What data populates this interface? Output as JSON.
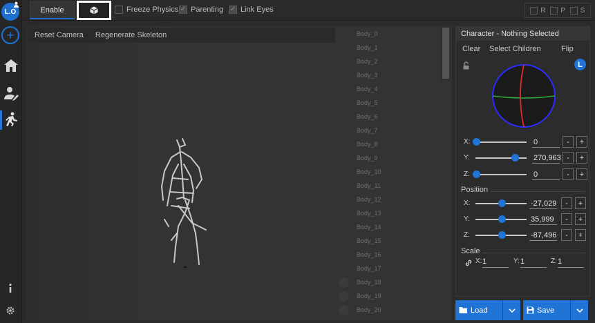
{
  "rail": {
    "avatar_text": "L.O",
    "items": [
      "user-add-icon",
      "home-icon",
      "character-edit-icon",
      "running-icon"
    ],
    "bottom": [
      "info-icon",
      "settings-icon"
    ]
  },
  "toolbar": {
    "enable_label": "Enable",
    "freeze_physics_label": "Freeze Physics",
    "freeze_physics_checked": false,
    "parenting_label": "Parenting",
    "parenting_checked": true,
    "link_eyes_label": "Link Eyes",
    "link_eyes_checked": true,
    "rps": [
      {
        "label": "R",
        "checked": false
      },
      {
        "label": "P",
        "checked": false
      },
      {
        "label": "S",
        "checked": false
      }
    ]
  },
  "viewport": {
    "reset_camera_label": "Reset Camera",
    "regenerate_skeleton_label": "Regenerate Skeleton",
    "bones": [
      "Body_0",
      "Body_1",
      "Body_2",
      "Body_3",
      "Body_4",
      "Body_5",
      "Body_6",
      "Body_7",
      "Body_8",
      "Body_9",
      "Body_10",
      "Body_11",
      "Body_12",
      "Body_13",
      "Body_14",
      "Body_15",
      "Body_16",
      "Body_17",
      "Body_18",
      "Body_19",
      "Body_20"
    ]
  },
  "panel": {
    "title": "Character - Nothing Selected",
    "clear_label": "Clear",
    "select_children_label": "Select Children",
    "flip_label": "Flip",
    "space_badge": "L",
    "rotation": {
      "x": {
        "label": "X:",
        "value": "0",
        "slider": 0.0
      },
      "y": {
        "label": "Y:",
        "value": "270,963",
        "slider": 0.75
      },
      "z": {
        "label": "Z:",
        "value": "0",
        "slider": 0.0
      }
    },
    "position_label": "Position",
    "position": {
      "x": {
        "label": "X:",
        "value": "-27,029",
        "slider": 0.5
      },
      "y": {
        "label": "Y:",
        "value": "35,999",
        "slider": 0.5
      },
      "z": {
        "label": "Z:",
        "value": "-87,496",
        "slider": 0.5
      }
    },
    "minus_label": "-",
    "plus_label": "+",
    "scale_label": "Scale",
    "scale": {
      "x": {
        "label": "X:",
        "value": "1"
      },
      "y": {
        "label": "Y:",
        "value": "1"
      },
      "z": {
        "label": "Z:",
        "value": "1"
      }
    }
  },
  "footer": {
    "load_label": "Load",
    "save_label": "Save"
  },
  "colors": {
    "accent": "#1f74d6",
    "background": "#2b2b2b",
    "panel": "#2c2c2c"
  }
}
